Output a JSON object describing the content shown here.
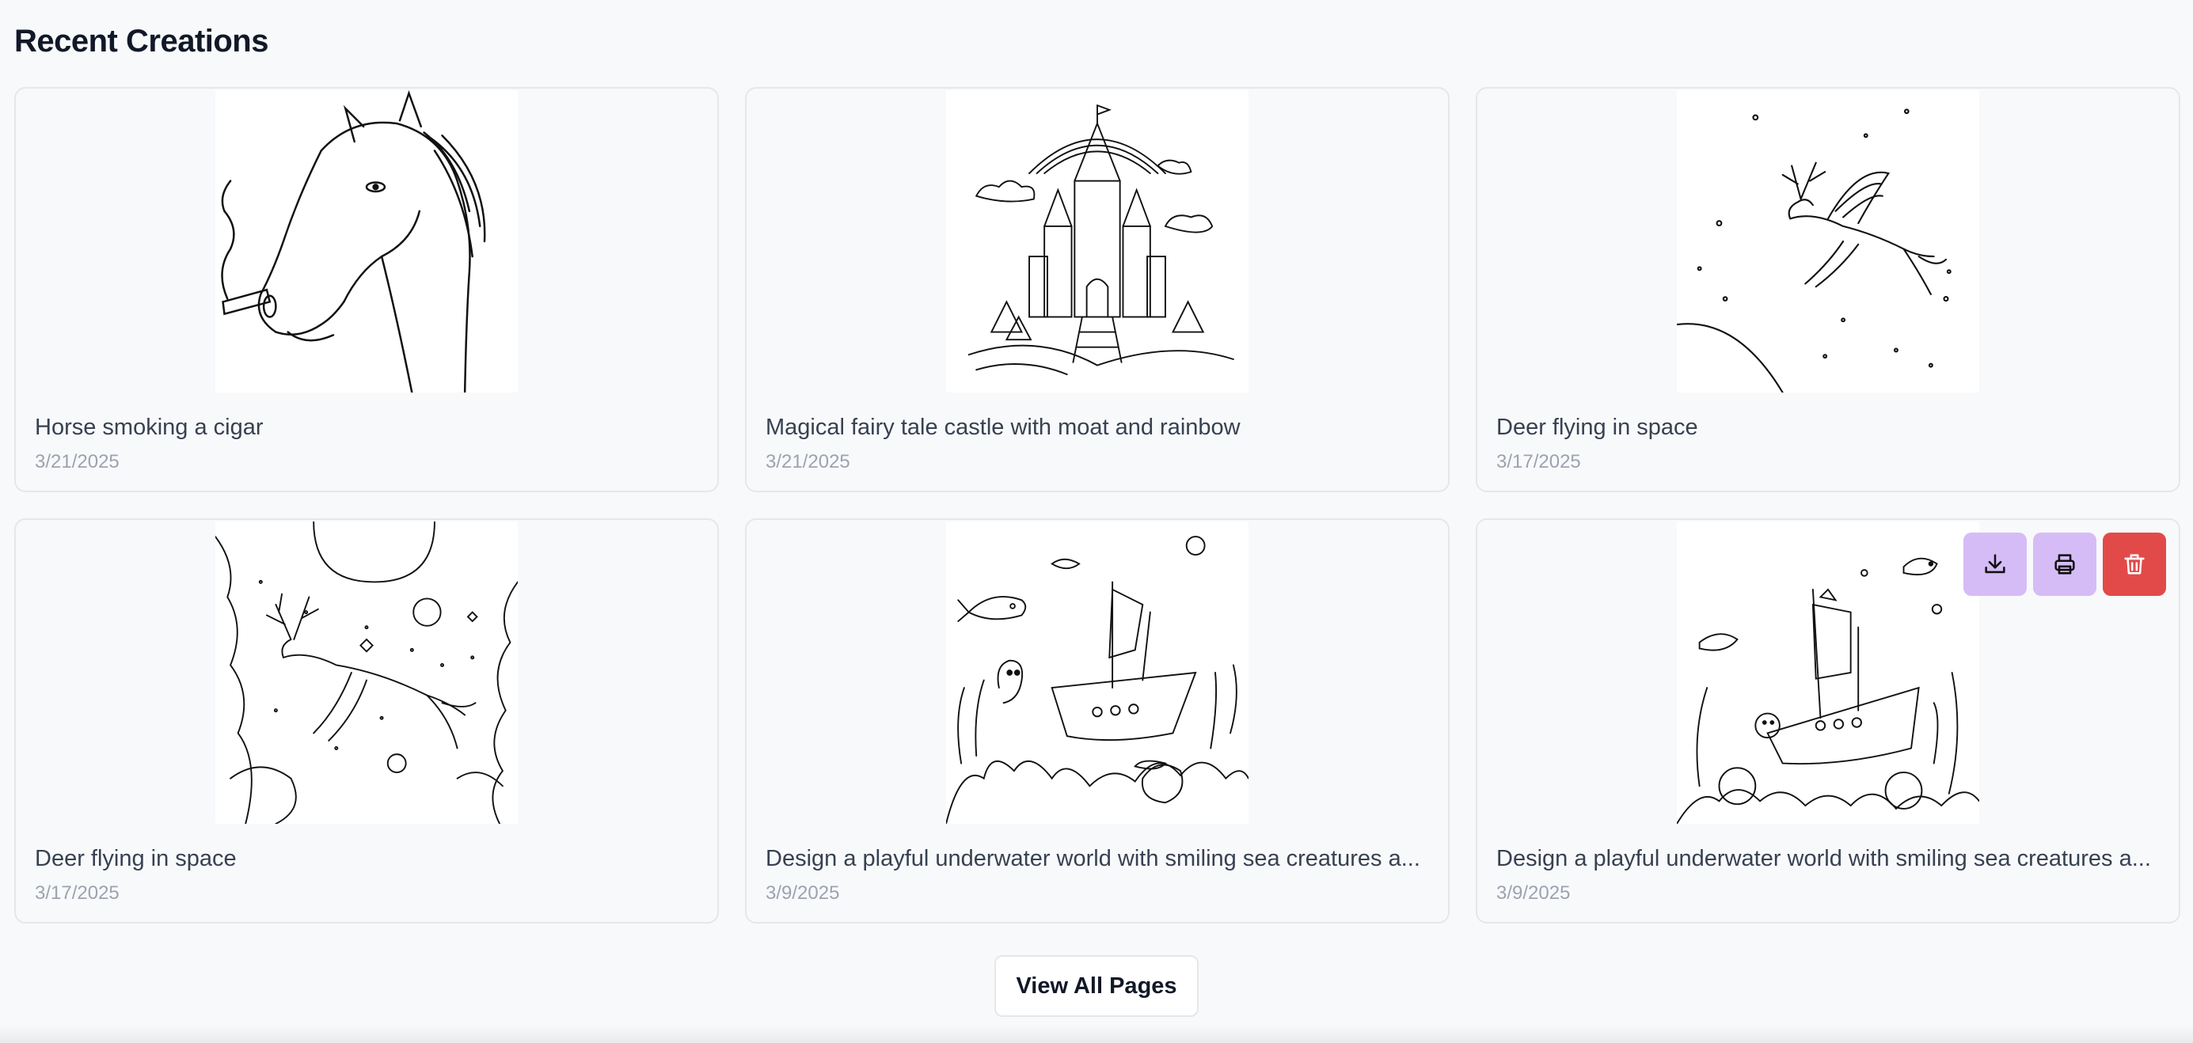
{
  "section": {
    "title": "Recent Creations"
  },
  "cards": [
    {
      "title": "Horse smoking a cigar",
      "date": "3/21/2025",
      "image": "horse-drawing"
    },
    {
      "title": "Magical fairy tale castle with moat and rainbow",
      "date": "3/21/2025",
      "image": "castle-drawing"
    },
    {
      "title": "Deer flying in space",
      "date": "3/17/2025",
      "image": "deer-space-drawing"
    },
    {
      "title": "Deer flying in space",
      "date": "3/17/2025",
      "image": "deer-space-detailed-drawing"
    },
    {
      "title": "Design a playful underwater world with smiling sea creatures a...",
      "date": "3/9/2025",
      "image": "underwater-ship-drawing"
    },
    {
      "title": "Design a playful underwater world with smiling sea creatures a...",
      "date": "3/9/2025",
      "image": "underwater-ship-drawing-2"
    }
  ],
  "card_actions": {
    "icons": [
      "download-icon",
      "printer-icon",
      "trash-icon"
    ]
  },
  "footer": {
    "view_all_label": "View All Pages"
  },
  "colors": {
    "action_purple": "#d6bcf6",
    "action_red": "#e24a4a",
    "background": "#f8f9fb"
  }
}
